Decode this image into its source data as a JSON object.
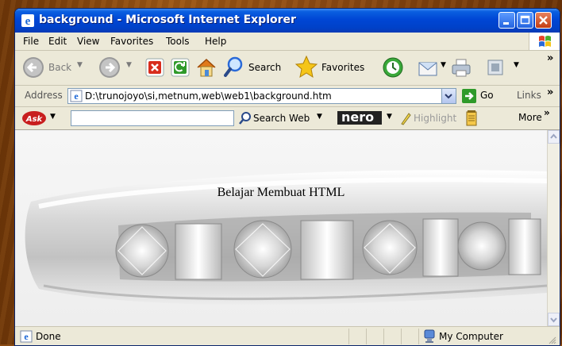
{
  "window": {
    "title": "background - Microsoft Internet Explorer"
  },
  "menu": [
    {
      "label": "File"
    },
    {
      "label": "Edit"
    },
    {
      "label": "View"
    },
    {
      "label": "Favorites"
    },
    {
      "label": "Tools"
    },
    {
      "label": "Help"
    }
  ],
  "toolbar": {
    "back_label": "Back",
    "search_label": "Search",
    "favorites_label": "Favorites"
  },
  "address": {
    "label": "Address",
    "value": "D:\\trunojoyo\\si,metnum,web\\web1\\background.htm",
    "go_label": "Go",
    "links_label": "Links"
  },
  "askbar": {
    "search_value": "",
    "search_web_label": "Search Web",
    "nero_label": "nero",
    "highlight_label": "Highlight",
    "more_label": "More"
  },
  "page": {
    "heading": "Belajar Membuat HTML"
  },
  "status": {
    "text": "Done",
    "zone": "My Computer"
  }
}
